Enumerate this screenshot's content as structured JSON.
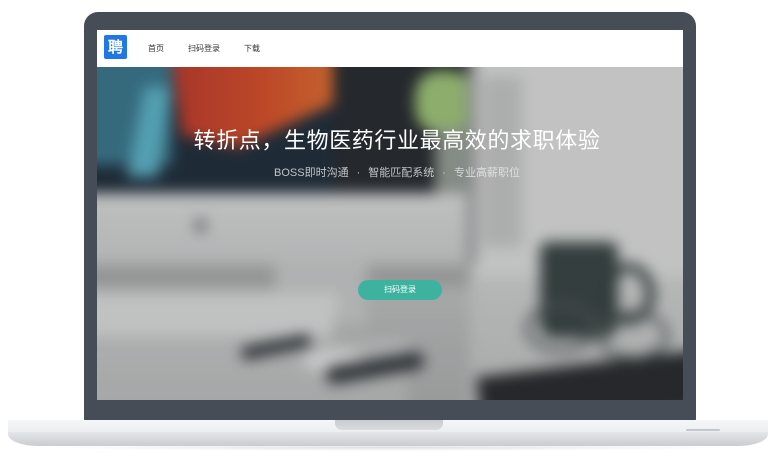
{
  "nav": {
    "logo": {
      "text": "聘",
      "icon": "brand-logo-icon"
    },
    "items": [
      {
        "label": "首页"
      },
      {
        "label": "扫码登录"
      },
      {
        "label": "下载"
      }
    ]
  },
  "hero": {
    "title": "转折点，生物医药行业最高效的求职体验",
    "subtitle": {
      "features": [
        "BOSS即时沟通",
        "智能匹配系统",
        "专业高薪职位"
      ],
      "separator": "·"
    },
    "cta_label": "扫码登录"
  },
  "colors": {
    "brand_blue": "#2178e3",
    "cta_green": "#3db39f",
    "laptop_frame": "#474d56",
    "laptop_base": "#eceef0",
    "nav_background": "#ffffff"
  }
}
